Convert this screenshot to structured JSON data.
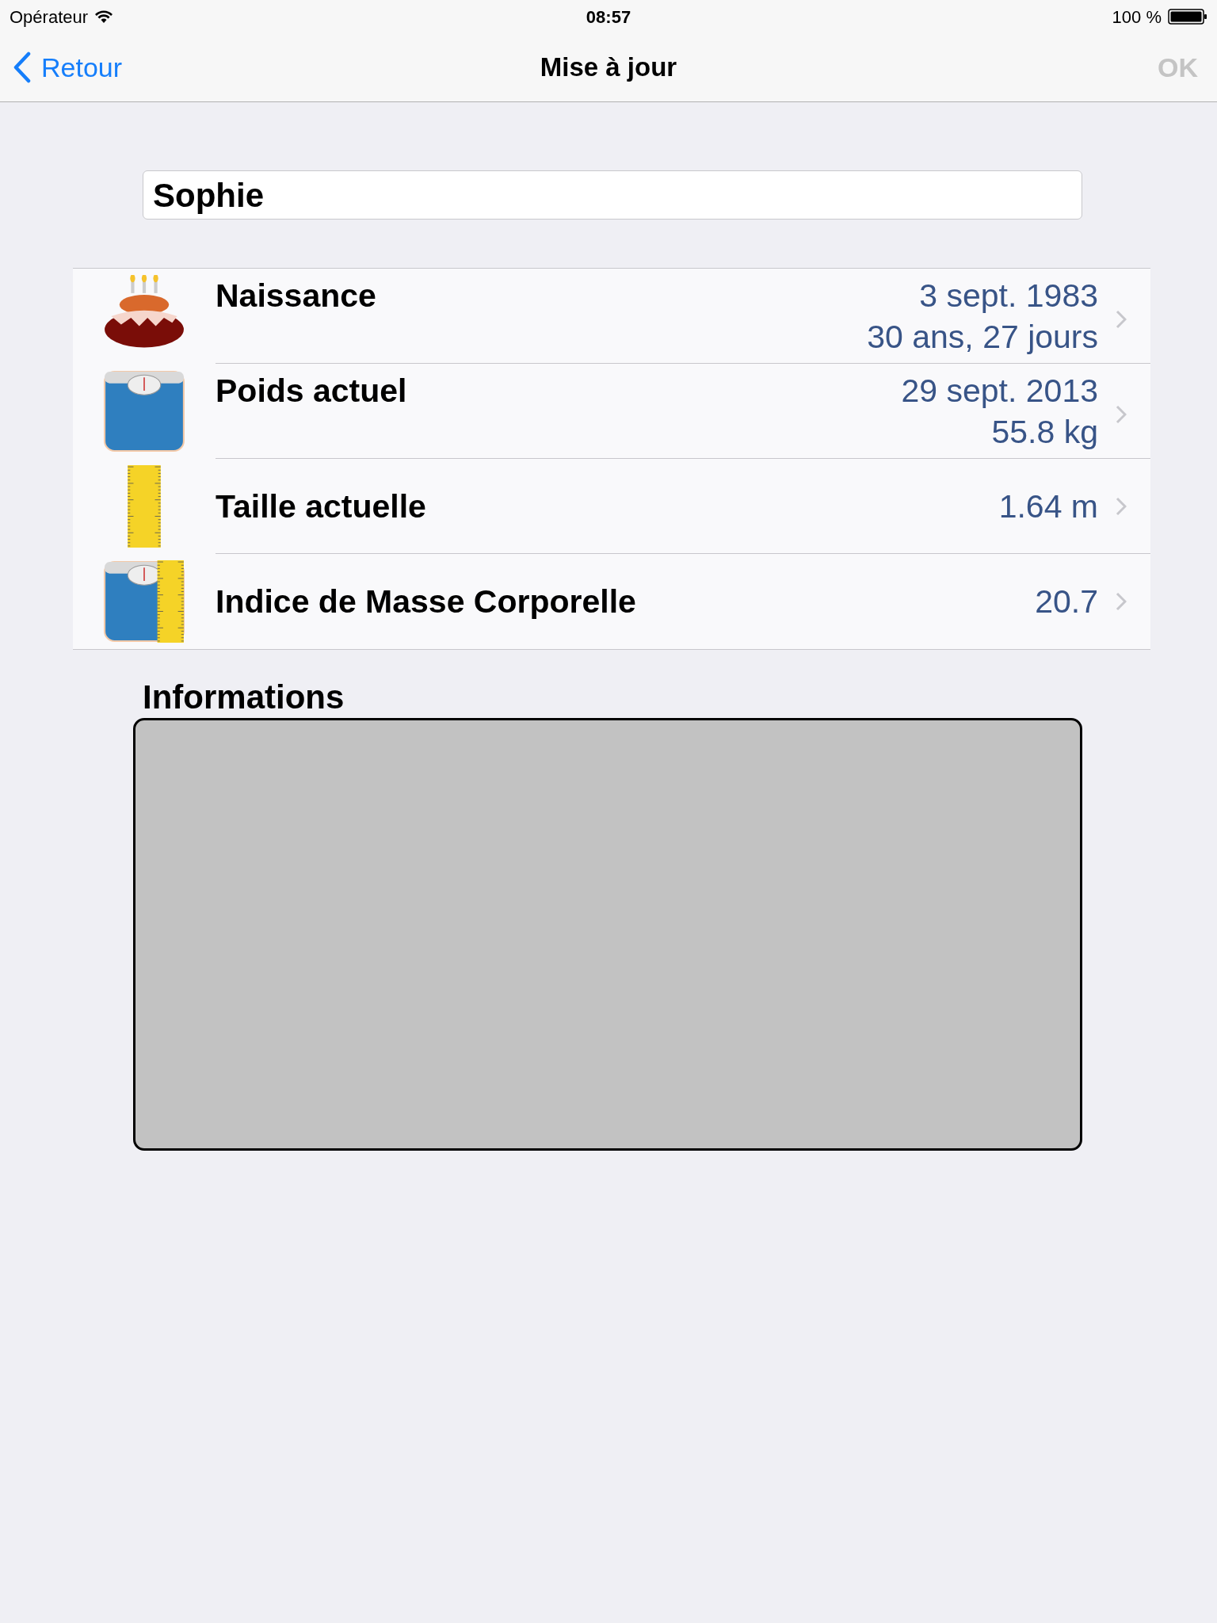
{
  "status_bar": {
    "carrier": "Opérateur",
    "time": "08:57",
    "battery": "100 %"
  },
  "nav": {
    "back": "Retour",
    "title": "Mise à jour",
    "action": {
      "label": "OK",
      "disabled": true
    }
  },
  "name_field": {
    "value": "Sophie"
  },
  "rows": [
    {
      "kind": "cake",
      "label": "Naissance",
      "values": [
        "3 sept. 1983",
        "30 ans, 27 jours"
      ]
    },
    {
      "kind": "scale",
      "label": "Poids actuel",
      "values": [
        "29 sept. 2013",
        "55.8 kg"
      ]
    },
    {
      "kind": "ruler",
      "label": "Taille actuelle",
      "values": [
        "1.64 m"
      ]
    },
    {
      "kind": "bmi",
      "label": "Indice de Masse Corporelle",
      "values": [
        "20.7"
      ]
    }
  ],
  "info": {
    "title": "Informations"
  }
}
